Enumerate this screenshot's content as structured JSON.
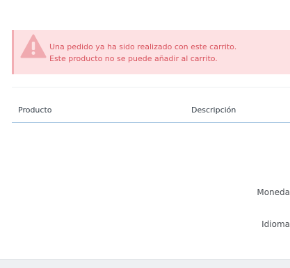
{
  "alert": {
    "icon": "warning-triangle-icon",
    "line1": "Una pedido ya ha sido realizado con este carrito.",
    "line2": "Este producto no se puede añadir al carrito.",
    "colors": {
      "background": "#fde1e3",
      "border": "#f2aeb4",
      "text": "#d9535e",
      "icon": "#f0aab0"
    }
  },
  "table": {
    "columns": [
      "Producto",
      "Descripción"
    ]
  },
  "settings": {
    "currency_label": "Moneda",
    "language_label": "Idioma"
  }
}
